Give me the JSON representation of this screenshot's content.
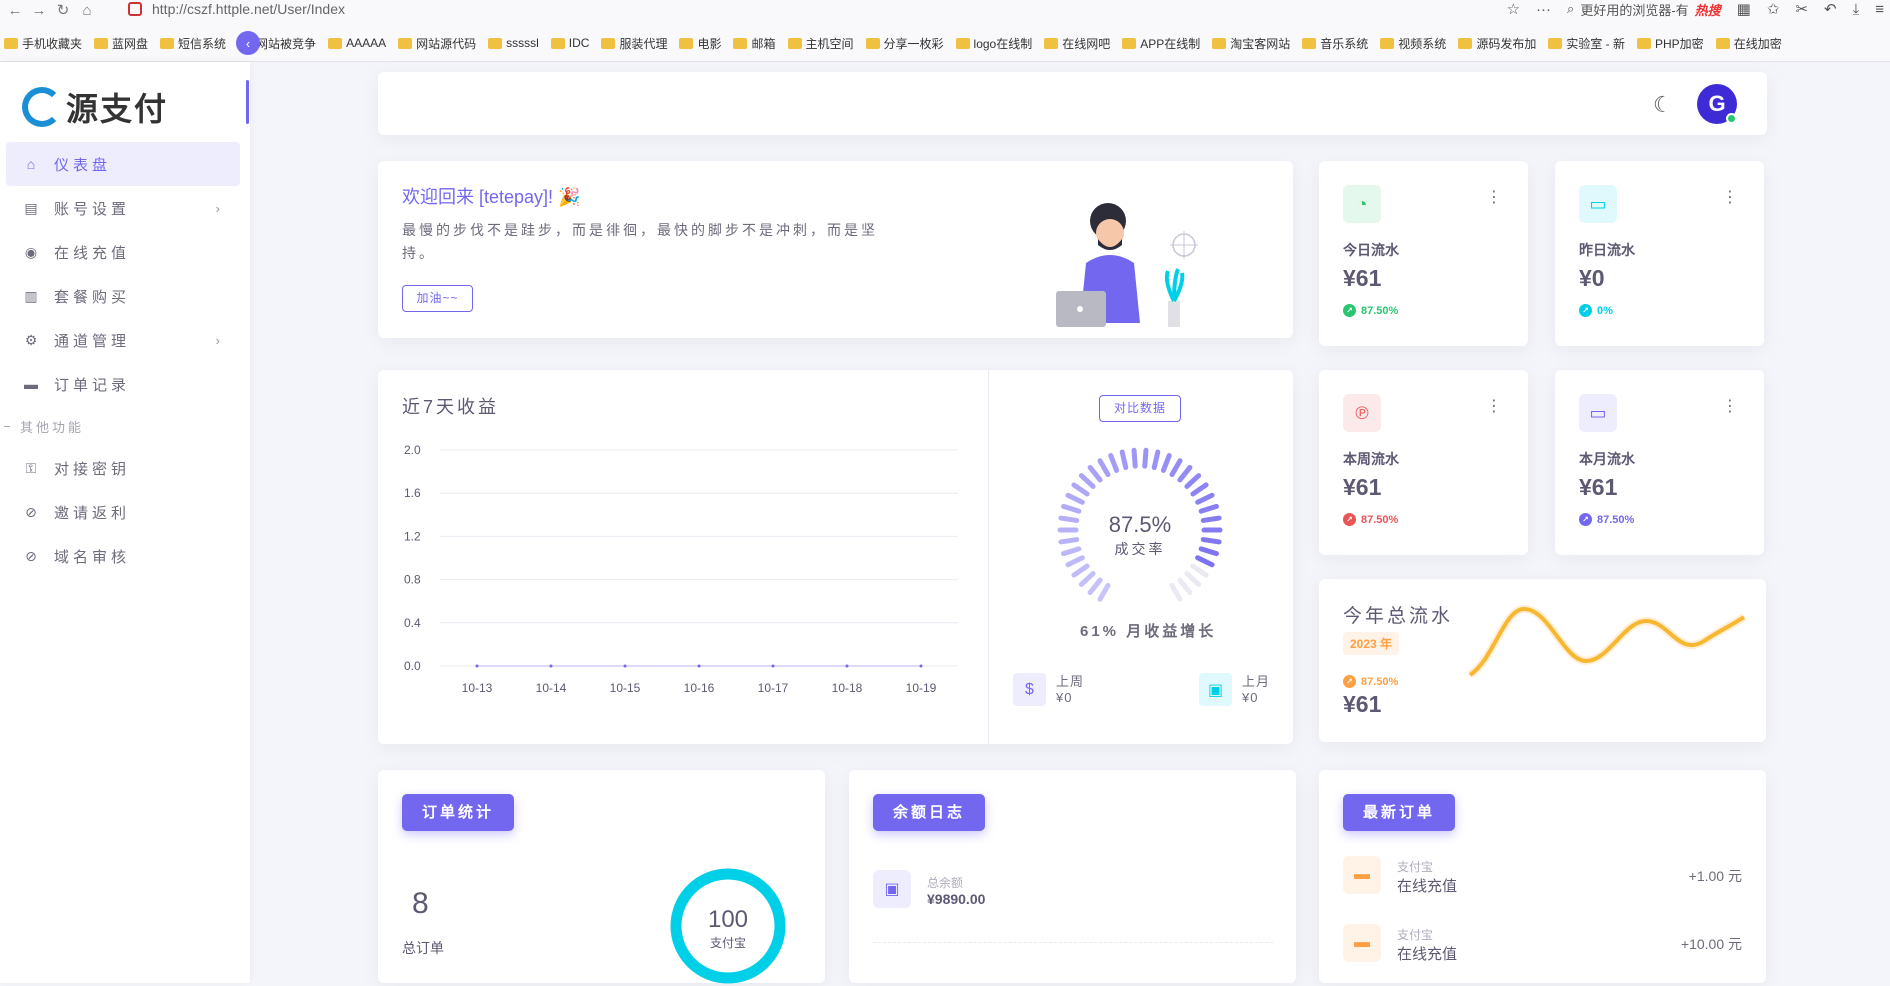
{
  "browser": {
    "url": "http://cszf.httple.net/User/Index",
    "search_text": "更好用的浏览器-有",
    "search_hot": "热搜",
    "bookmarks": [
      "手机收藏夹",
      "蓝网盘",
      "短信系统",
      "网站被竞争",
      "AAAAA",
      "网站源代码",
      "sssssl",
      "IDC",
      "服装代理",
      "电影",
      "邮箱",
      "主机空间",
      "分享一枚彩",
      "logo在线制",
      "在线网吧",
      "APP在线制",
      "淘宝客网站",
      "音乐系统",
      "视频系统",
      "源码发布加",
      "实验室 - 新",
      "PHP加密",
      "在线加密"
    ]
  },
  "sidebar": {
    "collapse_icon": "‹",
    "items": [
      {
        "label": "仪表盘",
        "icon": "home-icon",
        "active": true
      },
      {
        "label": "账号设置",
        "icon": "user-card-icon",
        "chevron": true
      },
      {
        "label": "在线充值",
        "icon": "camera-icon"
      },
      {
        "label": "套餐购买",
        "icon": "bag-icon"
      },
      {
        "label": "通道管理",
        "icon": "gear-icon",
        "chevron": true
      },
      {
        "label": "订单记录",
        "icon": "wallet-icon"
      }
    ],
    "section": "其他功能",
    "items2": [
      {
        "label": "对接密钥",
        "icon": "key-icon"
      },
      {
        "label": "邀请返利",
        "icon": "link-icon"
      },
      {
        "label": "域名审核",
        "icon": "link-icon"
      }
    ]
  },
  "header": {
    "avatar_letter": "G"
  },
  "welcome": {
    "title": "欢迎回来 [tetepay]!",
    "text": "最慢的步伐不是跬步，而是徘徊，最快的脚步不是冲刺，而是坚持。",
    "button": "加油~~"
  },
  "stats": [
    {
      "label": "今日流水",
      "value": "¥61",
      "pct": "87.50%",
      "color": "#28c76f",
      "bg": "#e5f8ed"
    },
    {
      "label": "昨日流水",
      "value": "¥0",
      "pct": "0%",
      "color": "#00cfe8",
      "bg": "#e0f9fc"
    },
    {
      "label": "本周流水",
      "value": "¥61",
      "pct": "87.50%",
      "color": "#ea5455",
      "bg": "#fceaea"
    },
    {
      "label": "本月流水",
      "value": "¥61",
      "pct": "87.50%",
      "color": "#7367f0",
      "bg": "#eeedfd"
    }
  ],
  "revenue": {
    "title": "近7天收益"
  },
  "chart_data": {
    "type": "line",
    "title": "近7天收益",
    "categories": [
      "10-13",
      "10-14",
      "10-15",
      "10-16",
      "10-17",
      "10-18",
      "10-19"
    ],
    "values": [
      0,
      0,
      0,
      0,
      0,
      0,
      0
    ],
    "yticks": [
      "2.0",
      "1.6",
      "1.2",
      "0.8",
      "0.4",
      "0.0"
    ],
    "ylim": [
      0,
      2.0
    ],
    "grid": true
  },
  "gauge": {
    "button": "对比数据",
    "value": 87.5,
    "value_text": "87.5%",
    "label": "成交率",
    "subtitle": "61% 月收益增长",
    "last_week_label": "上周",
    "last_week_value": "¥0",
    "last_month_label": "上月",
    "last_month_value": "¥0"
  },
  "year": {
    "title": "今年总流水",
    "year_badge": "2023 年",
    "pct": "87.50%",
    "value": "¥61"
  },
  "orders": {
    "button": "订单统计",
    "count": "8",
    "count_label": "总订单",
    "donut_value": "100",
    "donut_label": "支付宝",
    "donut_color": "#00cfe8"
  },
  "balance": {
    "button": "余额日志",
    "label": "总余额",
    "value": "¥9890.00"
  },
  "latest": {
    "button": "最新订单",
    "rows": [
      {
        "sub": "支付宝",
        "title": "在线充值",
        "amount": "+1.00 元"
      },
      {
        "sub": "支付宝",
        "title": "在线充值",
        "amount": "+10.00 元"
      }
    ]
  }
}
